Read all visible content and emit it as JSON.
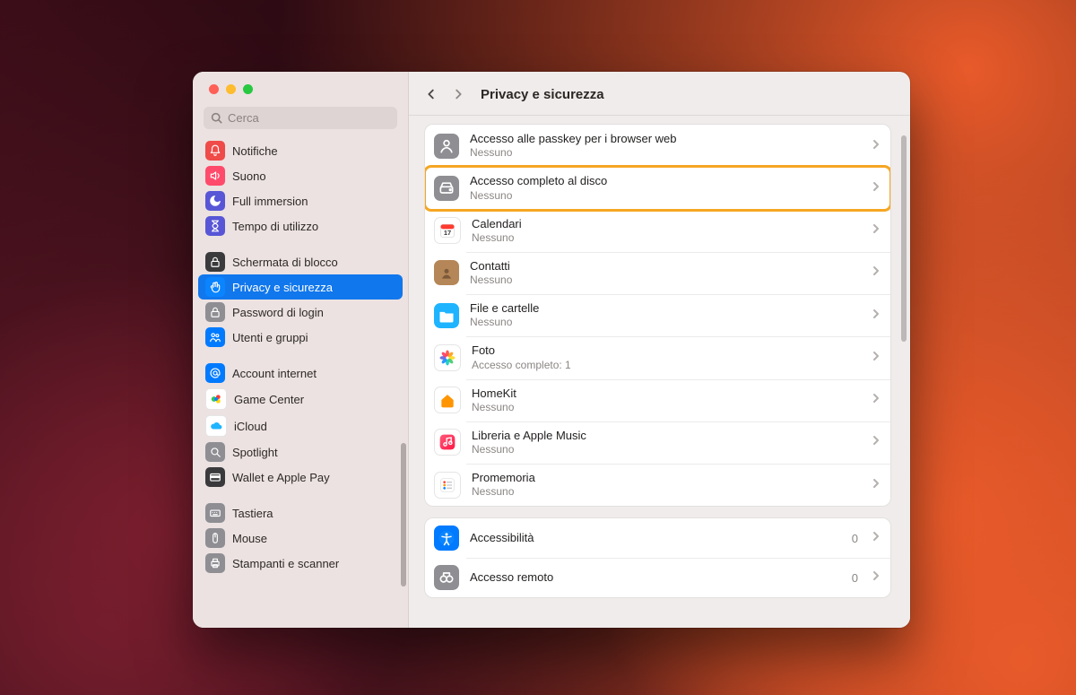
{
  "window": {
    "search_placeholder": "Cerca",
    "title": "Privacy e sicurezza"
  },
  "sidebar": {
    "groups": [
      {
        "items": [
          {
            "id": "notifiche",
            "label": "Notifiche",
            "iconBg": "bg-red",
            "glyph": "bell"
          },
          {
            "id": "suono",
            "label": "Suono",
            "iconBg": "bg-pink",
            "glyph": "speaker"
          },
          {
            "id": "full-immersion",
            "label": "Full immersion",
            "iconBg": "bg-indigo",
            "glyph": "moon"
          },
          {
            "id": "tempo-utilizzo",
            "label": "Tempo di utilizzo",
            "iconBg": "bg-indigo",
            "glyph": "hourglass"
          }
        ]
      },
      {
        "items": [
          {
            "id": "schermata-blocco",
            "label": "Schermata di blocco",
            "iconBg": "bg-dark",
            "glyph": "lock"
          },
          {
            "id": "privacy",
            "label": "Privacy e sicurezza",
            "iconBg": "bg-blueB",
            "glyph": "hand",
            "selected": true
          },
          {
            "id": "password-login",
            "label": "Password di login",
            "iconBg": "bg-grayL",
            "glyph": "lock"
          },
          {
            "id": "utenti-gruppi",
            "label": "Utenti e gruppi",
            "iconBg": "bg-blueA",
            "glyph": "users"
          }
        ]
      },
      {
        "items": [
          {
            "id": "account-internet",
            "label": "Account internet",
            "iconBg": "bg-blueA",
            "glyph": "at"
          },
          {
            "id": "game-center",
            "label": "Game Center",
            "iconBg": "bg-white",
            "glyph": "gc"
          },
          {
            "id": "icloud",
            "label": "iCloud",
            "iconBg": "bg-white",
            "glyph": "cloud"
          },
          {
            "id": "spotlight",
            "label": "Spotlight",
            "iconBg": "bg-grayL",
            "glyph": "search"
          },
          {
            "id": "wallet",
            "label": "Wallet e Apple Pay",
            "iconBg": "bg-dark",
            "glyph": "wallet"
          }
        ]
      },
      {
        "items": [
          {
            "id": "tastiera",
            "label": "Tastiera",
            "iconBg": "bg-grayL",
            "glyph": "keyboard"
          },
          {
            "id": "mouse",
            "label": "Mouse",
            "iconBg": "bg-grayL",
            "glyph": "mouse"
          },
          {
            "id": "stampanti",
            "label": "Stampanti e scanner",
            "iconBg": "bg-grayL",
            "glyph": "printer"
          }
        ]
      }
    ]
  },
  "main": {
    "cards": [
      {
        "rows": [
          {
            "id": "passkey",
            "title": "Accesso alle passkey per i browser web",
            "sub": "Nessuno",
            "iconBg": "bg-grayL",
            "glyph": "person"
          },
          {
            "id": "disk",
            "title": "Accesso completo al disco",
            "sub": "Nessuno",
            "iconBg": "bg-grayL",
            "glyph": "disk",
            "highlighted": true
          },
          {
            "id": "calendari",
            "title": "Calendari",
            "sub": "Nessuno",
            "iconBg": "bg-white",
            "glyph": "calendar"
          },
          {
            "id": "contatti",
            "title": "Contatti",
            "sub": "Nessuno",
            "iconBg": "#b58657",
            "glyph": "contacts"
          },
          {
            "id": "file",
            "title": "File e cartelle",
            "sub": "Nessuno",
            "iconBg": "bg-sky",
            "glyph": "folder"
          },
          {
            "id": "foto",
            "title": "Foto",
            "sub": "Accesso completo: 1",
            "iconBg": "bg-white",
            "glyph": "photos"
          },
          {
            "id": "homekit",
            "title": "HomeKit",
            "sub": "Nessuno",
            "iconBg": "bg-white",
            "glyph": "home"
          },
          {
            "id": "music",
            "title": "Libreria e Apple Music",
            "sub": "Nessuno",
            "iconBg": "bg-white",
            "glyph": "music"
          },
          {
            "id": "promemoria",
            "title": "Promemoria",
            "sub": "Nessuno",
            "iconBg": "bg-white",
            "glyph": "reminders"
          }
        ]
      },
      {
        "rows": [
          {
            "id": "accessibilita",
            "title": "Accessibilità",
            "iconBg": "bg-blueA",
            "glyph": "accessibility",
            "count": "0"
          },
          {
            "id": "accesso-remoto",
            "title": "Accesso remoto",
            "iconBg": "bg-grayL",
            "glyph": "binoc",
            "count": "0"
          }
        ]
      }
    ]
  }
}
